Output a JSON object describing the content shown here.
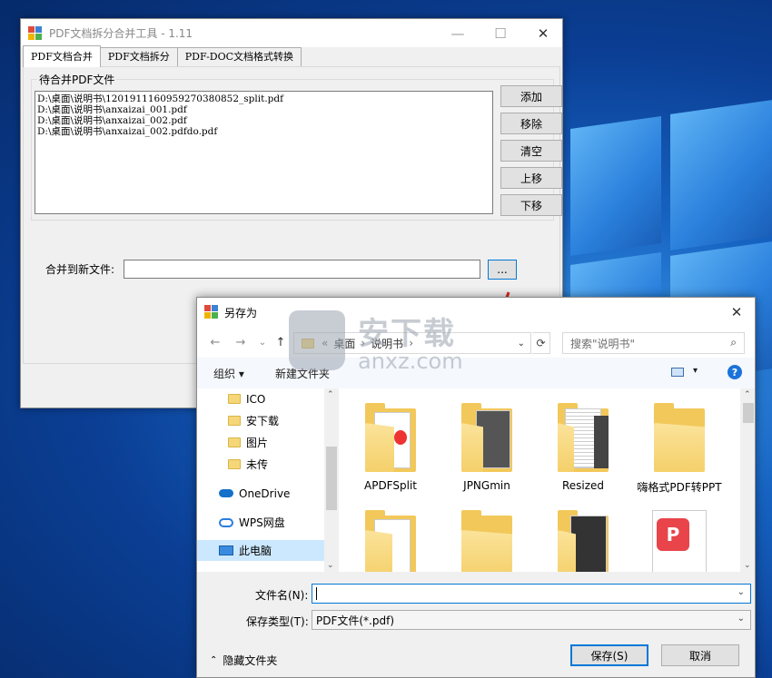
{
  "app": {
    "title": "PDF文档拆分合并工具 - 1.11",
    "controls": {
      "minimize": "—",
      "maximize": "☐",
      "close": "✕"
    },
    "tabs": [
      {
        "label": "PDF文档合并",
        "active": true
      },
      {
        "label": "PDF文档拆分",
        "active": false
      },
      {
        "label": "PDF-DOC文档格式转换",
        "active": false
      }
    ],
    "group_title": "待合并PDF文件",
    "files": [
      "D:\\桌面\\说明书\\1201911160959270380852_split.pdf",
      "D:\\桌面\\说明书\\anxaizai_001.pdf",
      "D:\\桌面\\说明书\\anxaizai_002.pdf",
      "D:\\桌面\\说明书\\anxaizai_002.pdfdo.pdf"
    ],
    "buttons": {
      "add": "添加",
      "remove": "移除",
      "clear": "清空",
      "up": "上移",
      "down": "下移"
    },
    "merge_label": "合并到新文件:",
    "merge_value": "",
    "browse_label": "..."
  },
  "dialog": {
    "title": "另存为",
    "close": "✕",
    "nav": {
      "back": "←",
      "forward": "→",
      "recent": "⌄",
      "up": "↑"
    },
    "breadcrumb": [
      "«",
      "桌面",
      "›",
      "说明书",
      "›"
    ],
    "refresh": "⟳",
    "search_placeholder": "搜索\"说明书\"",
    "toolbar": {
      "organize": "组织 ▾",
      "new_folder": "新建文件夹",
      "view": "▾",
      "help": "?"
    },
    "nav_items": [
      {
        "label": "ICO",
        "icon": "folder-icon"
      },
      {
        "label": "安下载",
        "icon": "folder-icon"
      },
      {
        "label": "图片",
        "icon": "folder-icon"
      },
      {
        "label": "未传",
        "icon": "folder-icon"
      },
      {
        "label": "OneDrive",
        "icon": "cloud-icon"
      },
      {
        "label": "WPS网盘",
        "icon": "cloud-icon"
      },
      {
        "label": "此电脑",
        "icon": "computer-icon"
      }
    ],
    "files": [
      {
        "name": "APDFSplit"
      },
      {
        "name": "JPNGmin"
      },
      {
        "name": "Resized"
      },
      {
        "name": "嗨格式PDF转PPT"
      }
    ],
    "filename_label": "文件名(N):",
    "filename_value": "",
    "filetype_label": "保存类型(T):",
    "filetype_value": "PDF文件(*.pdf)",
    "hide_folders": "隐藏文件夹",
    "save": "保存(S)",
    "cancel": "取消"
  },
  "watermark": {
    "text": "安下载",
    "url": "anxz.com"
  },
  "colors": {
    "accent": "#0078d7",
    "folder": "#f2c85a",
    "selected": "#cce8ff",
    "arrow": "#d9261c"
  }
}
